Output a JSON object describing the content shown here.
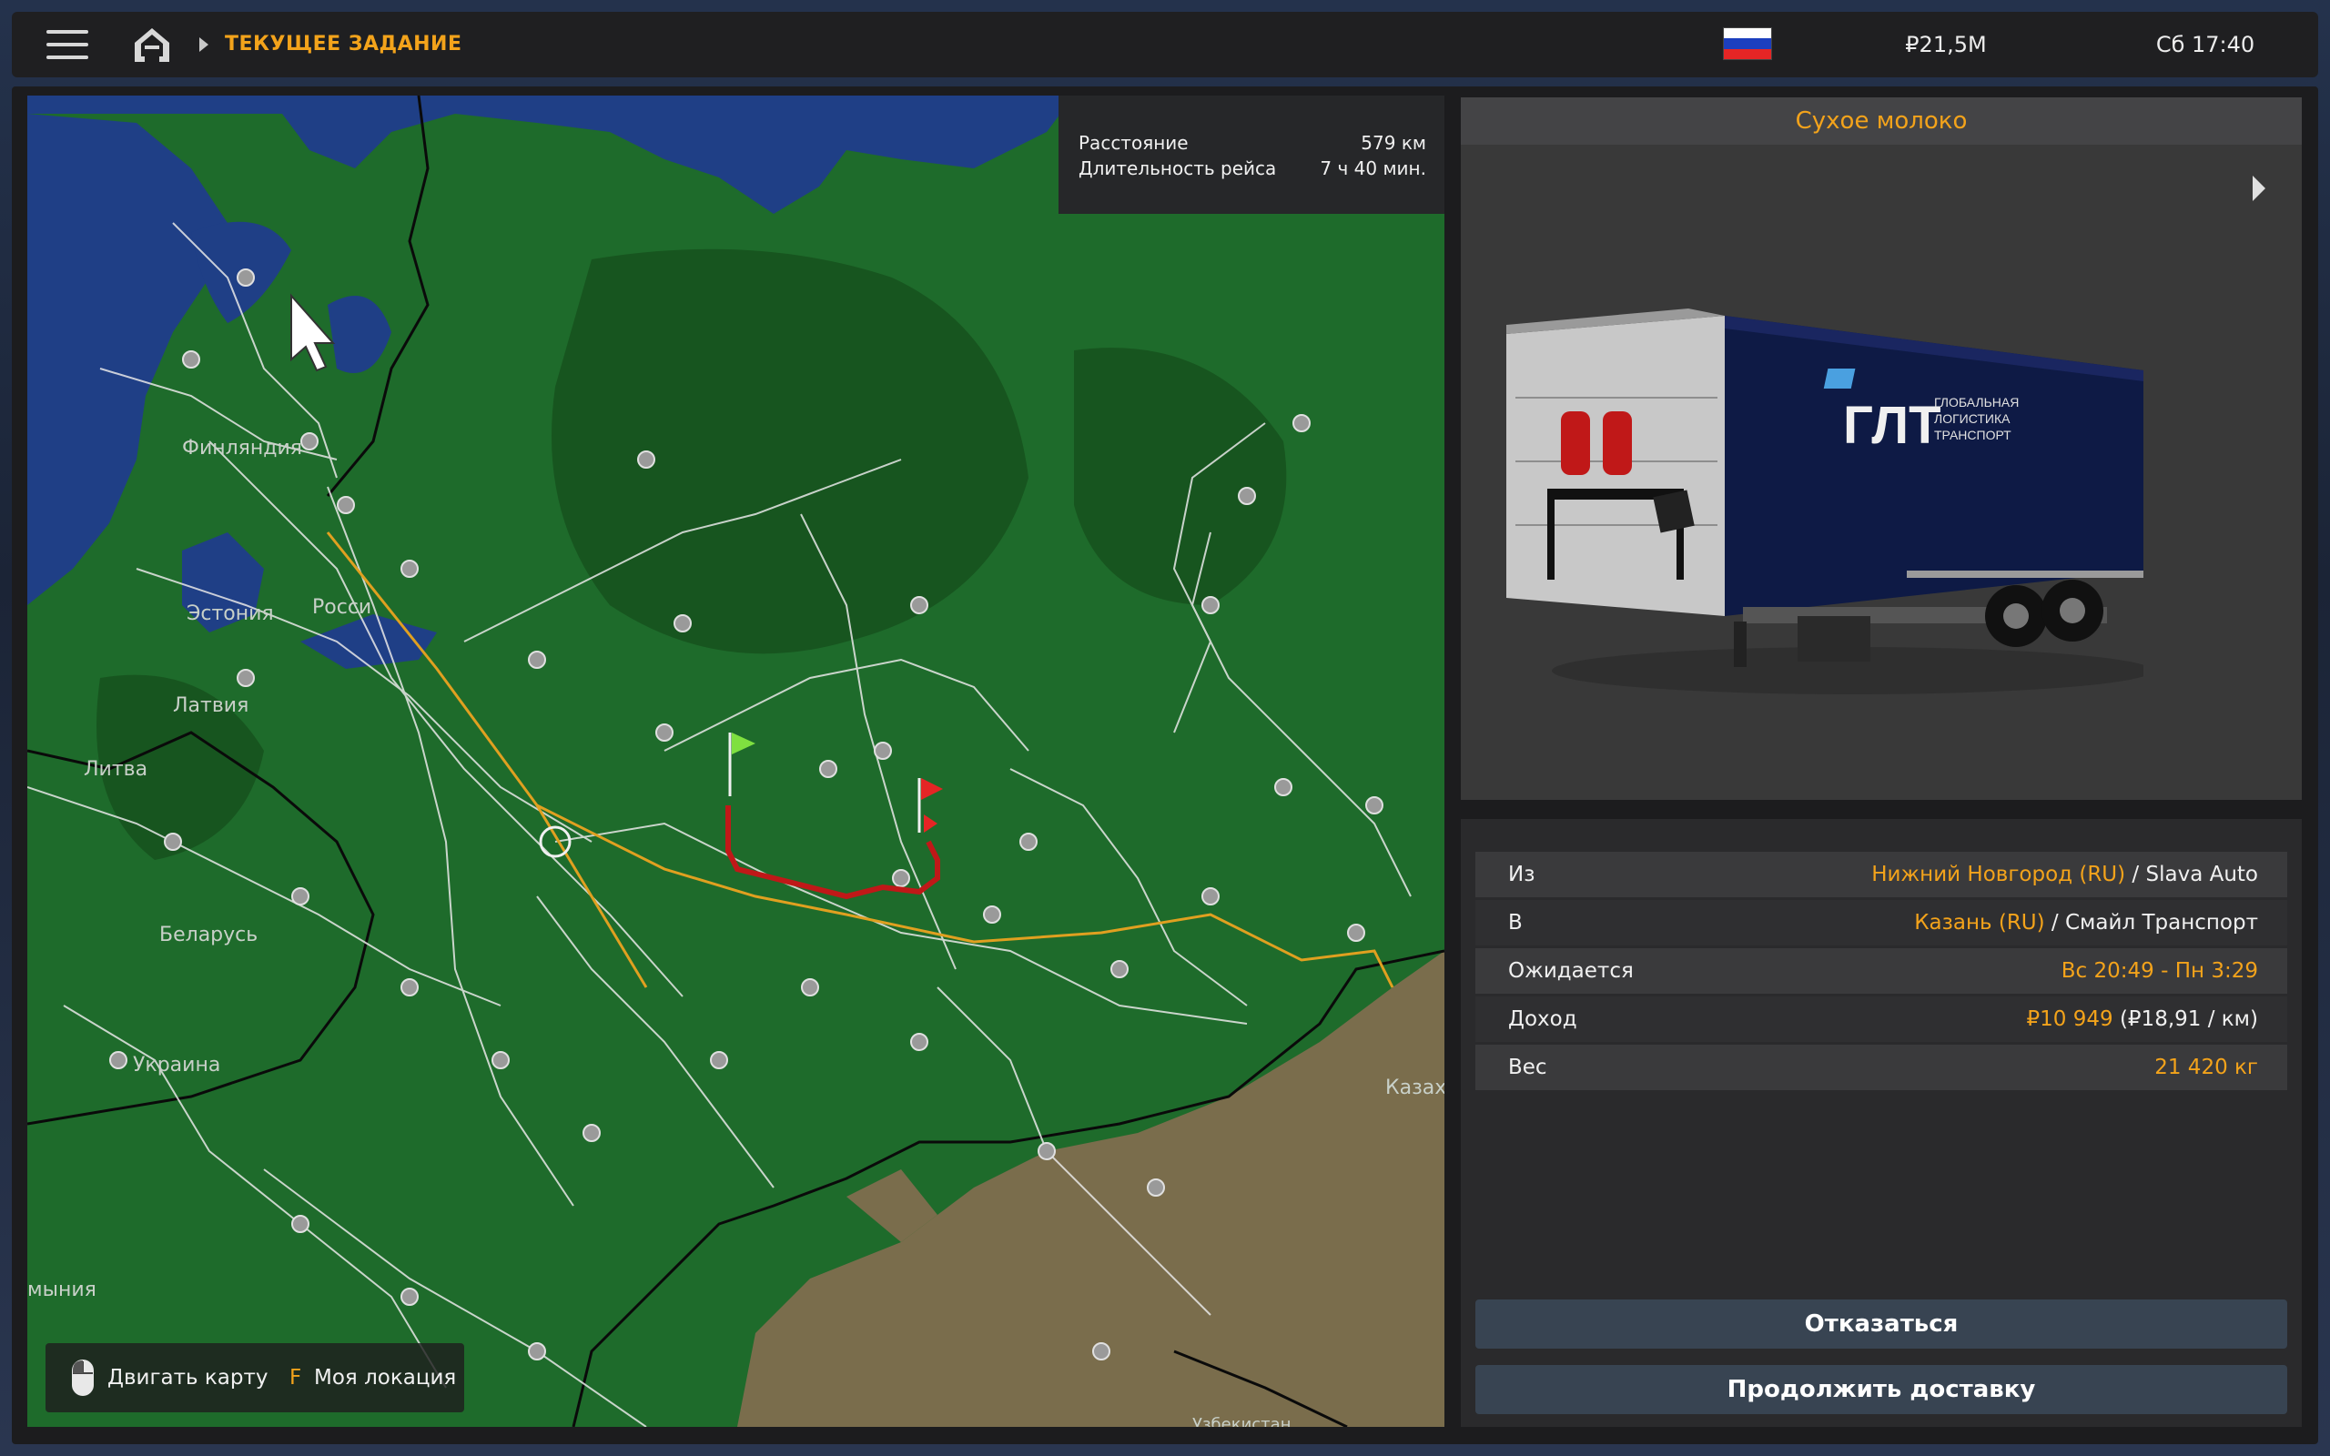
{
  "topbar": {
    "title": "ТЕКУЩЕЕ ЗАДАНИЕ",
    "money": "₽21,5M",
    "clock": "Сб 17:40",
    "flag_colors": [
      "#ffffff",
      "#1c3fbf",
      "#e52525"
    ],
    "icons": [
      "hamburger-menu-icon",
      "home-icon",
      "chevron-right-icon",
      "russia-flag-icon"
    ]
  },
  "trip": {
    "distance_label": "Расстояние",
    "distance_value": "579 км",
    "duration_label": "Длительность рейса",
    "duration_value": "7 ч 40 мин."
  },
  "map": {
    "labels": {
      "finland": "Финляндия",
      "estonia": "Эстония",
      "russia": "Росси",
      "latvia": "Латвия",
      "lithuania": "Литва",
      "belarus": "Беларусь",
      "ukraine": "Украина",
      "romania": "мыния",
      "kazakhstan": "Казах",
      "uzbekistan": "Узбекистан"
    },
    "colors": {
      "land": "#1e6b2b",
      "forest": "#17551f",
      "water": "#1f3f86",
      "steppe": "#7a6d4c",
      "route": "#c01818",
      "highway": "#e0a020"
    },
    "hint": {
      "move": "Двигать карту",
      "key": "F",
      "location": "Моя локация"
    }
  },
  "cargo": {
    "name": "Сухое молоко",
    "trailer_brand": "ГЛТ",
    "trailer_tagline": [
      "ГЛОБАЛЬНАЯ",
      "ЛОГИСТИКА",
      "ТРАНСПОРТ"
    ],
    "details": [
      {
        "label": "Из",
        "value_highlight": "Нижний Новгород (RU)",
        "value_rest": " / Slava Auto"
      },
      {
        "label": "В",
        "value_highlight": "Казань (RU)",
        "value_rest": " / Смайл Транспорт"
      },
      {
        "label": "Ожидается",
        "value_highlight": "Вс 20:49 - Пн 3:29",
        "value_rest": ""
      },
      {
        "label": "Доход",
        "value_highlight": "₽10 949",
        "value_rest": " (₽18,91 / км)"
      },
      {
        "label": "Вес",
        "value_highlight": "21 420 кг",
        "value_rest": ""
      }
    ],
    "decline_button": "Отказаться",
    "continue_button": "Продолжить доставку"
  }
}
